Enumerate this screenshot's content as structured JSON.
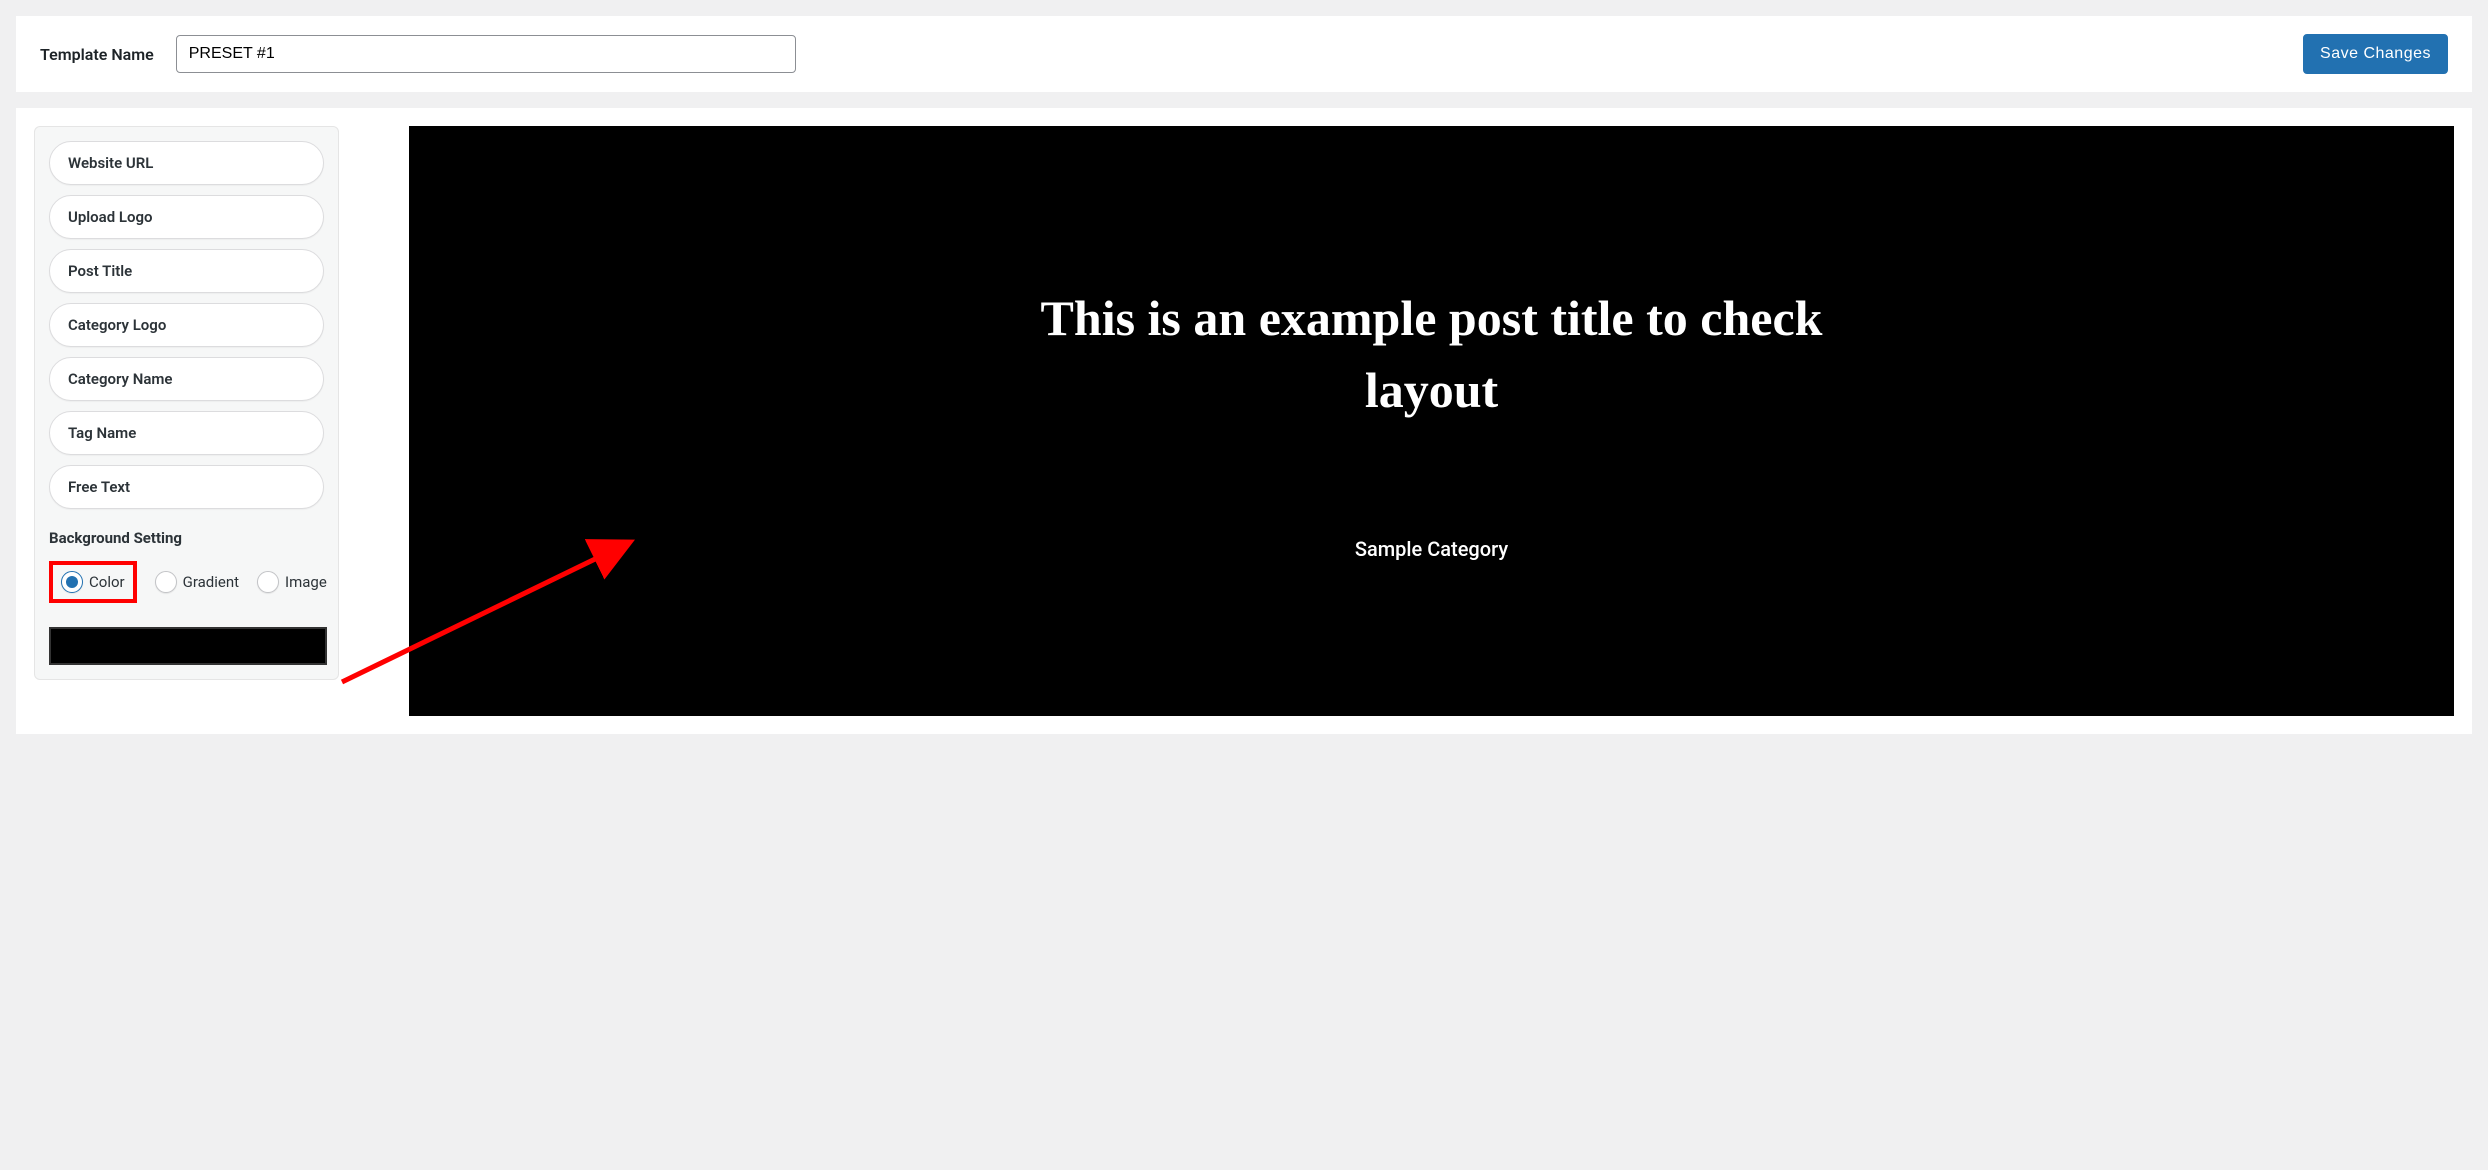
{
  "header": {
    "label": "Template Name",
    "value": "PRESET #1",
    "save_label": "Save Changes"
  },
  "sidebar": {
    "items": [
      "Website URL",
      "Upload Logo",
      "Post Title",
      "Category Logo",
      "Category Name",
      "Tag Name",
      "Free Text"
    ],
    "bg_label": "Background Setting",
    "bg_options": {
      "color": "Color",
      "gradient": "Gradient",
      "image": "Image"
    },
    "bg_selected": "color",
    "bg_color_value": "#000000"
  },
  "preview": {
    "title": "This is an example post title to check layout",
    "category": "Sample Category",
    "bg": "#000000"
  },
  "annotation": {
    "arrow_color": "#ff0000"
  }
}
